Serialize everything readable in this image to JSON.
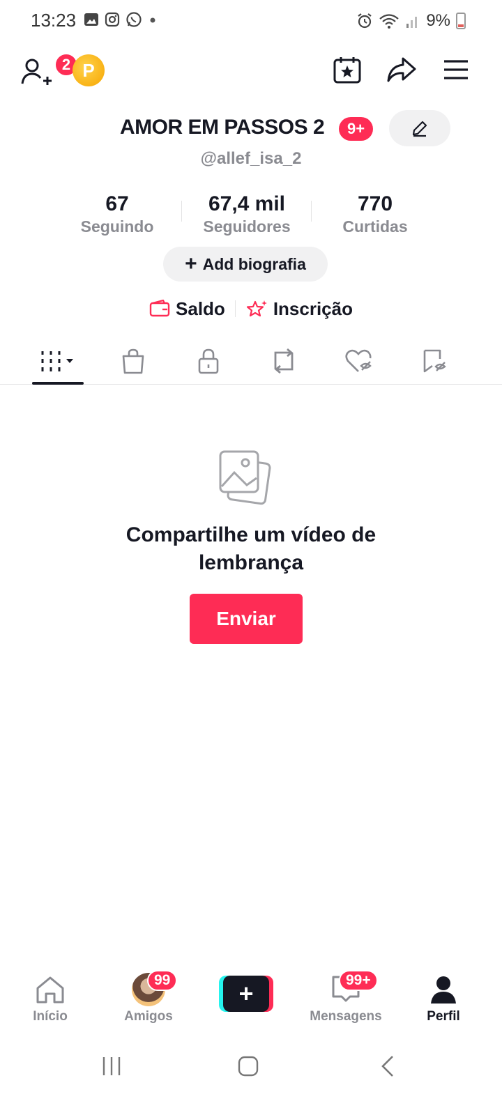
{
  "status_bar": {
    "time": "13:23",
    "battery": "9%"
  },
  "header": {
    "friend_requests_badge": "2",
    "coin_letter": "P"
  },
  "profile": {
    "name": "AMOR EM PASSOS 2",
    "name_badge": "9+",
    "username": "@allef_isa_2"
  },
  "stats": [
    {
      "value": "67",
      "label": "Seguindo"
    },
    {
      "value": "67,4 mil",
      "label": "Seguidores"
    },
    {
      "value": "770",
      "label": "Curtidas"
    }
  ],
  "bio_button": {
    "plus": "+",
    "label": "Add biografia"
  },
  "links": {
    "balance": "Saldo",
    "subscription": "Inscrição"
  },
  "empty_state": {
    "title_line1": "Compartilhe um vídeo de",
    "title_line2": "lembrança",
    "button": "Enviar"
  },
  "bottom_nav": {
    "home": "Início",
    "friends": "Amigos",
    "friends_badge": "99",
    "create": "+",
    "messages": "Mensagens",
    "messages_badge": "99+",
    "profile": "Perfil"
  },
  "colors": {
    "accent": "#fe2c55",
    "text": "#161823",
    "muted": "#8a8b91"
  }
}
